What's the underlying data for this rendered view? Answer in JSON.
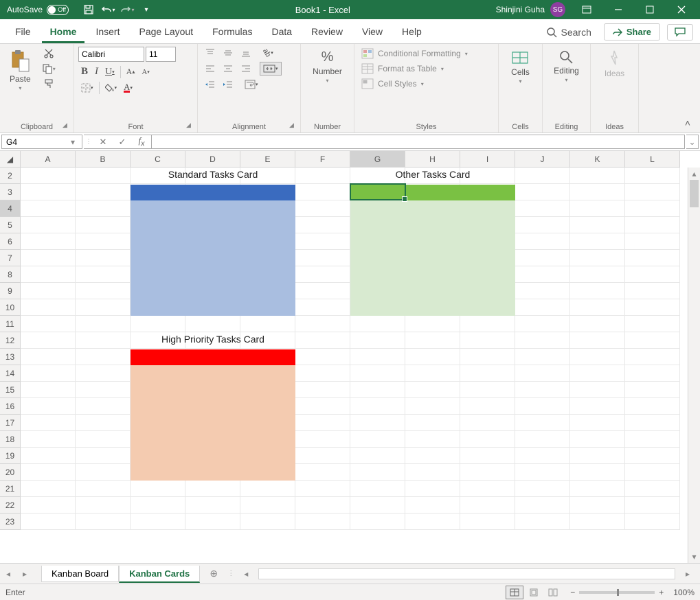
{
  "titlebar": {
    "autosave": "AutoSave",
    "autosave_state": "Off",
    "title": "Book1  -  Excel",
    "user": "Shinjini Guha",
    "initials": "SG"
  },
  "tabs": {
    "file": "File",
    "home": "Home",
    "insert": "Insert",
    "page": "Page Layout",
    "formulas": "Formulas",
    "data": "Data",
    "review": "Review",
    "view": "View",
    "help": "Help",
    "search": "Search",
    "share": "Share"
  },
  "ribbon": {
    "clipboard": {
      "label": "Clipboard",
      "paste": "Paste"
    },
    "font": {
      "label": "Font",
      "name": "Calibri",
      "size": "11"
    },
    "alignment": {
      "label": "Alignment"
    },
    "number": {
      "label": "Number",
      "btn": "Number"
    },
    "styles": {
      "label": "Styles",
      "cond": "Conditional Formatting",
      "table": "Format as Table",
      "cell": "Cell Styles"
    },
    "cells": {
      "label": "Cells",
      "btn": "Cells"
    },
    "editing": {
      "label": "Editing",
      "btn": "Editing"
    },
    "ideas": {
      "label": "Ideas",
      "btn": "Ideas"
    }
  },
  "namebox": "G4",
  "formula": "",
  "cols": [
    "A",
    "B",
    "C",
    "D",
    "E",
    "F",
    "G",
    "H",
    "I",
    "J",
    "K",
    "L"
  ],
  "rows": [
    "2",
    "3",
    "4",
    "5",
    "6",
    "7",
    "8",
    "9",
    "10",
    "11",
    "12",
    "13",
    "14",
    "15",
    "16",
    "17",
    "18",
    "19",
    "20",
    "21",
    "22",
    "23"
  ],
  "cards": {
    "standard": "Standard Tasks Card",
    "other": "Other Tasks Card",
    "priority": "High Priority Tasks Card"
  },
  "sheets": {
    "board": "Kanban Board",
    "cards": "Kanban Cards"
  },
  "status": {
    "mode": "Enter",
    "zoom": "100%"
  }
}
